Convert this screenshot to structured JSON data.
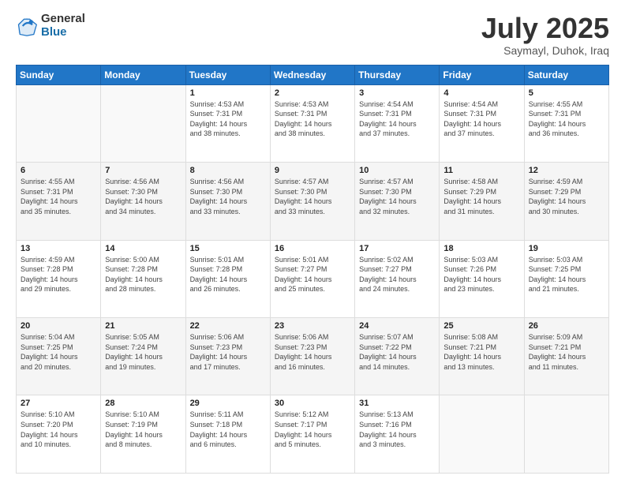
{
  "logo": {
    "general": "General",
    "blue": "Blue"
  },
  "title": "July 2025",
  "location": "Saymayl, Duhok, Iraq",
  "weekdays": [
    "Sunday",
    "Monday",
    "Tuesday",
    "Wednesday",
    "Thursday",
    "Friday",
    "Saturday"
  ],
  "weeks": [
    [
      {
        "day": "",
        "info": ""
      },
      {
        "day": "",
        "info": ""
      },
      {
        "day": "1",
        "info": "Sunrise: 4:53 AM\nSunset: 7:31 PM\nDaylight: 14 hours\nand 38 minutes."
      },
      {
        "day": "2",
        "info": "Sunrise: 4:53 AM\nSunset: 7:31 PM\nDaylight: 14 hours\nand 38 minutes."
      },
      {
        "day": "3",
        "info": "Sunrise: 4:54 AM\nSunset: 7:31 PM\nDaylight: 14 hours\nand 37 minutes."
      },
      {
        "day": "4",
        "info": "Sunrise: 4:54 AM\nSunset: 7:31 PM\nDaylight: 14 hours\nand 37 minutes."
      },
      {
        "day": "5",
        "info": "Sunrise: 4:55 AM\nSunset: 7:31 PM\nDaylight: 14 hours\nand 36 minutes."
      }
    ],
    [
      {
        "day": "6",
        "info": "Sunrise: 4:55 AM\nSunset: 7:31 PM\nDaylight: 14 hours\nand 35 minutes."
      },
      {
        "day": "7",
        "info": "Sunrise: 4:56 AM\nSunset: 7:30 PM\nDaylight: 14 hours\nand 34 minutes."
      },
      {
        "day": "8",
        "info": "Sunrise: 4:56 AM\nSunset: 7:30 PM\nDaylight: 14 hours\nand 33 minutes."
      },
      {
        "day": "9",
        "info": "Sunrise: 4:57 AM\nSunset: 7:30 PM\nDaylight: 14 hours\nand 33 minutes."
      },
      {
        "day": "10",
        "info": "Sunrise: 4:57 AM\nSunset: 7:30 PM\nDaylight: 14 hours\nand 32 minutes."
      },
      {
        "day": "11",
        "info": "Sunrise: 4:58 AM\nSunset: 7:29 PM\nDaylight: 14 hours\nand 31 minutes."
      },
      {
        "day": "12",
        "info": "Sunrise: 4:59 AM\nSunset: 7:29 PM\nDaylight: 14 hours\nand 30 minutes."
      }
    ],
    [
      {
        "day": "13",
        "info": "Sunrise: 4:59 AM\nSunset: 7:28 PM\nDaylight: 14 hours\nand 29 minutes."
      },
      {
        "day": "14",
        "info": "Sunrise: 5:00 AM\nSunset: 7:28 PM\nDaylight: 14 hours\nand 28 minutes."
      },
      {
        "day": "15",
        "info": "Sunrise: 5:01 AM\nSunset: 7:28 PM\nDaylight: 14 hours\nand 26 minutes."
      },
      {
        "day": "16",
        "info": "Sunrise: 5:01 AM\nSunset: 7:27 PM\nDaylight: 14 hours\nand 25 minutes."
      },
      {
        "day": "17",
        "info": "Sunrise: 5:02 AM\nSunset: 7:27 PM\nDaylight: 14 hours\nand 24 minutes."
      },
      {
        "day": "18",
        "info": "Sunrise: 5:03 AM\nSunset: 7:26 PM\nDaylight: 14 hours\nand 23 minutes."
      },
      {
        "day": "19",
        "info": "Sunrise: 5:03 AM\nSunset: 7:25 PM\nDaylight: 14 hours\nand 21 minutes."
      }
    ],
    [
      {
        "day": "20",
        "info": "Sunrise: 5:04 AM\nSunset: 7:25 PM\nDaylight: 14 hours\nand 20 minutes."
      },
      {
        "day": "21",
        "info": "Sunrise: 5:05 AM\nSunset: 7:24 PM\nDaylight: 14 hours\nand 19 minutes."
      },
      {
        "day": "22",
        "info": "Sunrise: 5:06 AM\nSunset: 7:23 PM\nDaylight: 14 hours\nand 17 minutes."
      },
      {
        "day": "23",
        "info": "Sunrise: 5:06 AM\nSunset: 7:23 PM\nDaylight: 14 hours\nand 16 minutes."
      },
      {
        "day": "24",
        "info": "Sunrise: 5:07 AM\nSunset: 7:22 PM\nDaylight: 14 hours\nand 14 minutes."
      },
      {
        "day": "25",
        "info": "Sunrise: 5:08 AM\nSunset: 7:21 PM\nDaylight: 14 hours\nand 13 minutes."
      },
      {
        "day": "26",
        "info": "Sunrise: 5:09 AM\nSunset: 7:21 PM\nDaylight: 14 hours\nand 11 minutes."
      }
    ],
    [
      {
        "day": "27",
        "info": "Sunrise: 5:10 AM\nSunset: 7:20 PM\nDaylight: 14 hours\nand 10 minutes."
      },
      {
        "day": "28",
        "info": "Sunrise: 5:10 AM\nSunset: 7:19 PM\nDaylight: 14 hours\nand 8 minutes."
      },
      {
        "day": "29",
        "info": "Sunrise: 5:11 AM\nSunset: 7:18 PM\nDaylight: 14 hours\nand 6 minutes."
      },
      {
        "day": "30",
        "info": "Sunrise: 5:12 AM\nSunset: 7:17 PM\nDaylight: 14 hours\nand 5 minutes."
      },
      {
        "day": "31",
        "info": "Sunrise: 5:13 AM\nSunset: 7:16 PM\nDaylight: 14 hours\nand 3 minutes."
      },
      {
        "day": "",
        "info": ""
      },
      {
        "day": "",
        "info": ""
      }
    ]
  ]
}
